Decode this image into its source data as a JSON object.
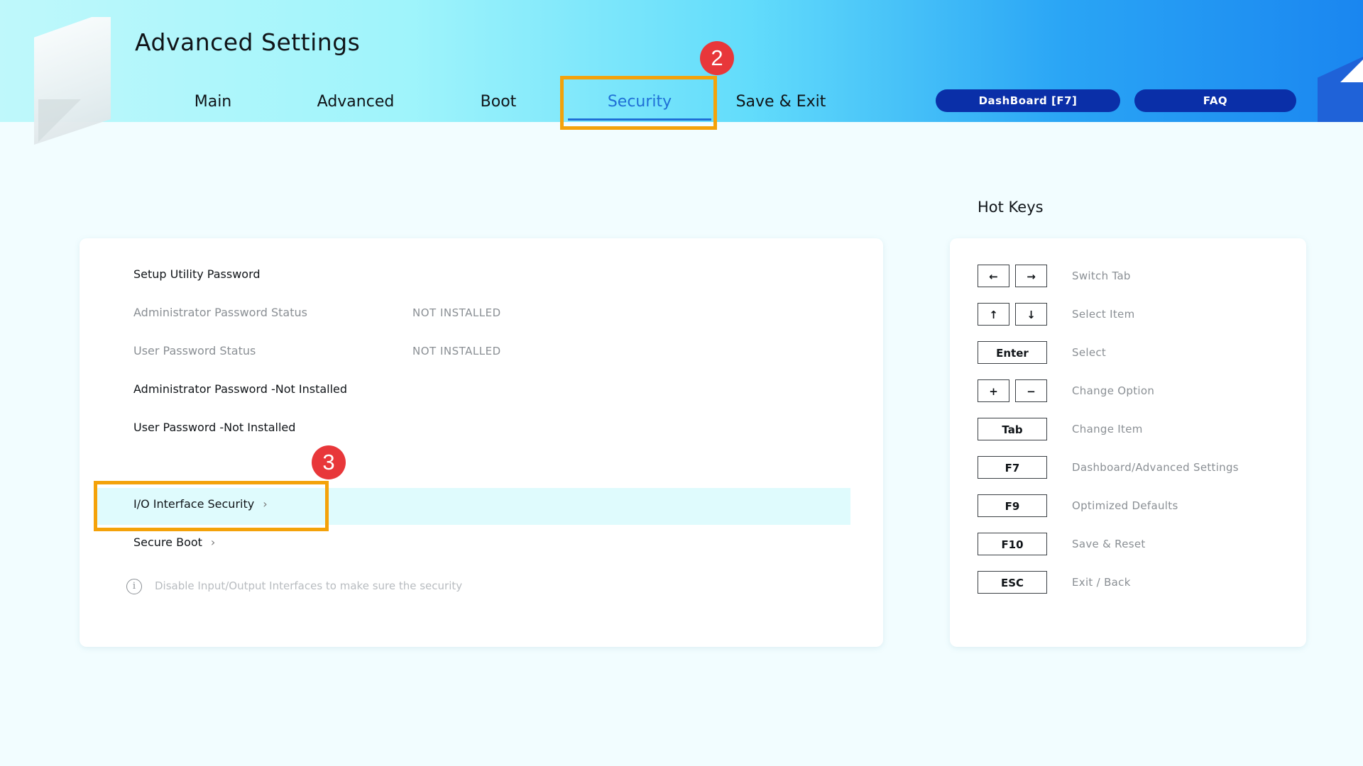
{
  "title": "Advanced Settings",
  "tabs": [
    {
      "label": "Main"
    },
    {
      "label": "Advanced"
    },
    {
      "label": "Boot"
    },
    {
      "label": "Security"
    },
    {
      "label": "Save & Exit"
    }
  ],
  "active_tab": "Security",
  "header_buttons": {
    "dashboard": "DashBoard [F7]",
    "faq": "FAQ"
  },
  "annotations": {
    "step2": "2",
    "step3": "3"
  },
  "security": {
    "section_title": "Setup Utility Password",
    "admin_status_label": "Administrator Password Status",
    "admin_status_value": "NOT INSTALLED",
    "user_status_label": "User Password Status",
    "user_status_value": "NOT INSTALLED",
    "admin_password": "Administrator Password -Not Installed",
    "user_password": "User Password -Not Installed",
    "io_security": "I/O Interface Security",
    "secure_boot": "Secure Boot",
    "info": "Disable Input/Output Interfaces to make sure the security"
  },
  "hotkeys": {
    "title": "Hot Keys",
    "items": [
      {
        "keys": [
          "←",
          "→"
        ],
        "desc": "Switch Tab"
      },
      {
        "keys": [
          "↑",
          "↓"
        ],
        "desc": "Select Item"
      },
      {
        "keys": [
          "Enter"
        ],
        "desc": "Select"
      },
      {
        "keys": [
          "+",
          "−"
        ],
        "desc": "Change Option"
      },
      {
        "keys": [
          "Tab"
        ],
        "desc": "Change Item"
      },
      {
        "keys": [
          "F7"
        ],
        "desc": "Dashboard/Advanced Settings"
      },
      {
        "keys": [
          "F9"
        ],
        "desc": "Optimized Defaults"
      },
      {
        "keys": [
          "F10"
        ],
        "desc": "Save & Reset"
      },
      {
        "keys": [
          "ESC"
        ],
        "desc": "Exit / Back"
      }
    ]
  },
  "colors": {
    "accent": "#1f6fd6",
    "highlight": "#f4a20a",
    "badge": "#e8373a",
    "pill": "#0a2fa8"
  },
  "icons": {
    "info": "info-circle-icon",
    "chevron": "chevron-right-icon"
  }
}
